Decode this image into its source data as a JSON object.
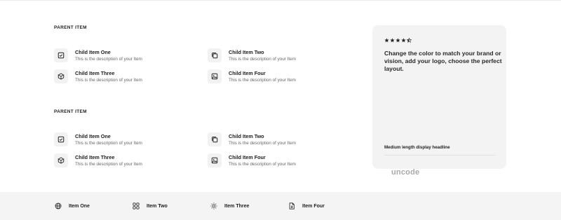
{
  "sections": [
    {
      "title": "PARENT ITEM",
      "items": [
        {
          "title": "Child Item One",
          "desc": "This is the description of your Item",
          "icon": "square-check-icon"
        },
        {
          "title": "Child Item Two",
          "desc": "This is the description of your Item",
          "icon": "copy-icon"
        },
        {
          "title": "Child Item Three",
          "desc": "This is the description of your Item",
          "icon": "box-icon"
        },
        {
          "title": "Child Item Four",
          "desc": "This is the description of your Item",
          "icon": "image-icon"
        }
      ]
    },
    {
      "title": "PARENT ITEM",
      "items": [
        {
          "title": "Child Item One",
          "desc": "This is the description of your Item",
          "icon": "square-check-icon"
        },
        {
          "title": "Child Item Two",
          "desc": "This is the description of your Item",
          "icon": "copy-icon"
        },
        {
          "title": "Child Item Three",
          "desc": "This is the description of your Item",
          "icon": "box-icon"
        },
        {
          "title": "Child Item Four",
          "desc": "This is the description of your Item",
          "icon": "image-icon"
        }
      ]
    }
  ],
  "card": {
    "rating": 4.5,
    "heading": "Change the color to match your brand or vision, add your logo, choose the perfect layout.",
    "subheading": "Medium length display headline",
    "logo": "uncode"
  },
  "footer": {
    "items": [
      {
        "label": "Item One",
        "icon": "globe-icon"
      },
      {
        "label": "Item Two",
        "icon": "grid-icon"
      },
      {
        "label": "Item Three",
        "icon": "sun-icon"
      },
      {
        "label": "Item Four",
        "icon": "file-download-icon"
      }
    ]
  }
}
